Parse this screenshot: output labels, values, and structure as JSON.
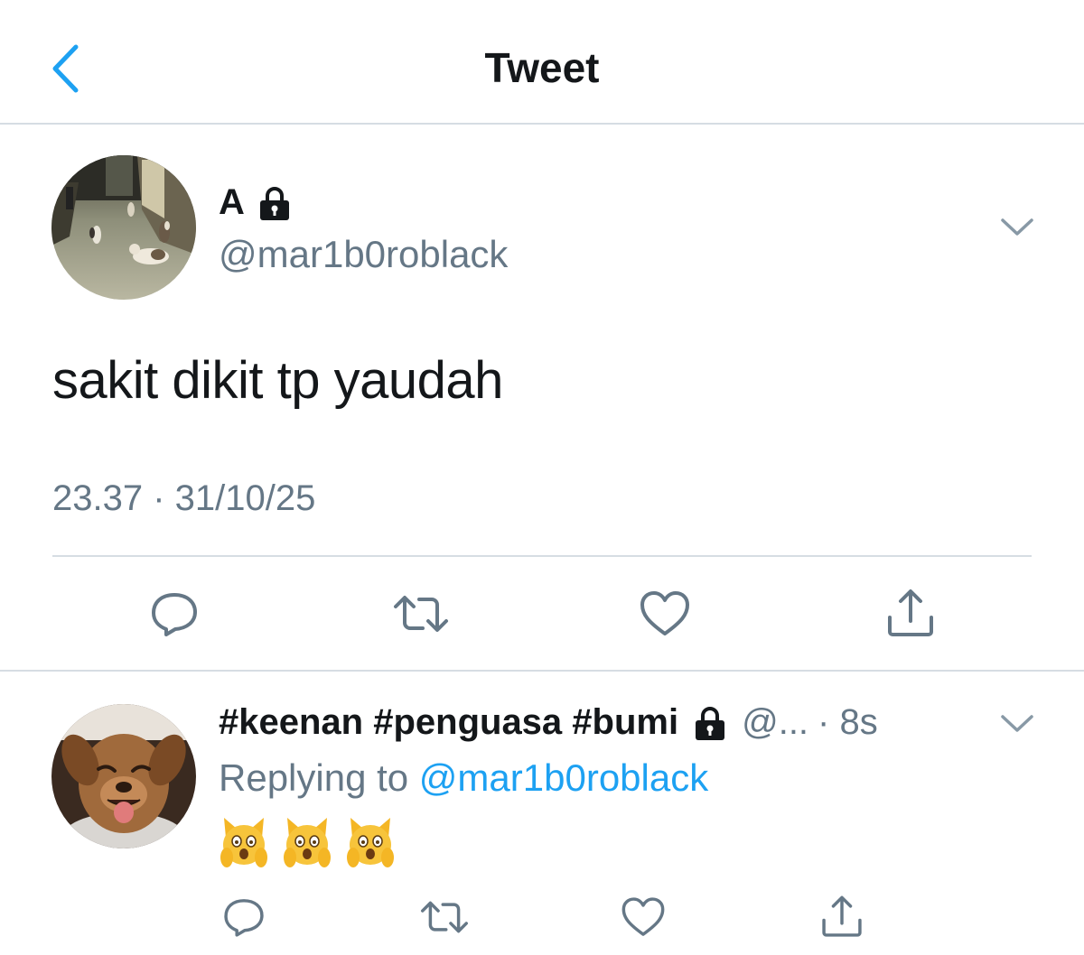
{
  "nav": {
    "title": "Tweet",
    "back_icon": "chevron-left-icon"
  },
  "tweet": {
    "display_name": "A",
    "protected_icon": "lock-icon",
    "handle": "@mar1b0roblack",
    "text": "sakit dikit tp yaudah",
    "timestamp": "23.37 · 31/10/25",
    "actions": [
      "reply-icon",
      "retweet-icon",
      "like-icon",
      "share-icon"
    ]
  },
  "reply": {
    "display_name": "#keenan #penguasa #bumi",
    "protected_icon": "lock-icon",
    "handle": "@...",
    "time": "· 8s",
    "replying_prefix": "Replying to",
    "replying_handle": "@mar1b0roblack",
    "emojis": [
      "weary-cat-face",
      "weary-cat-face",
      "weary-cat-face"
    ],
    "actions": [
      "reply-icon",
      "retweet-icon",
      "like-icon",
      "share-icon"
    ]
  },
  "colors": {
    "accent": "#1da1f2",
    "secondary_text": "#657786",
    "primary_text": "#14171a",
    "divider": "#d6dde3"
  }
}
